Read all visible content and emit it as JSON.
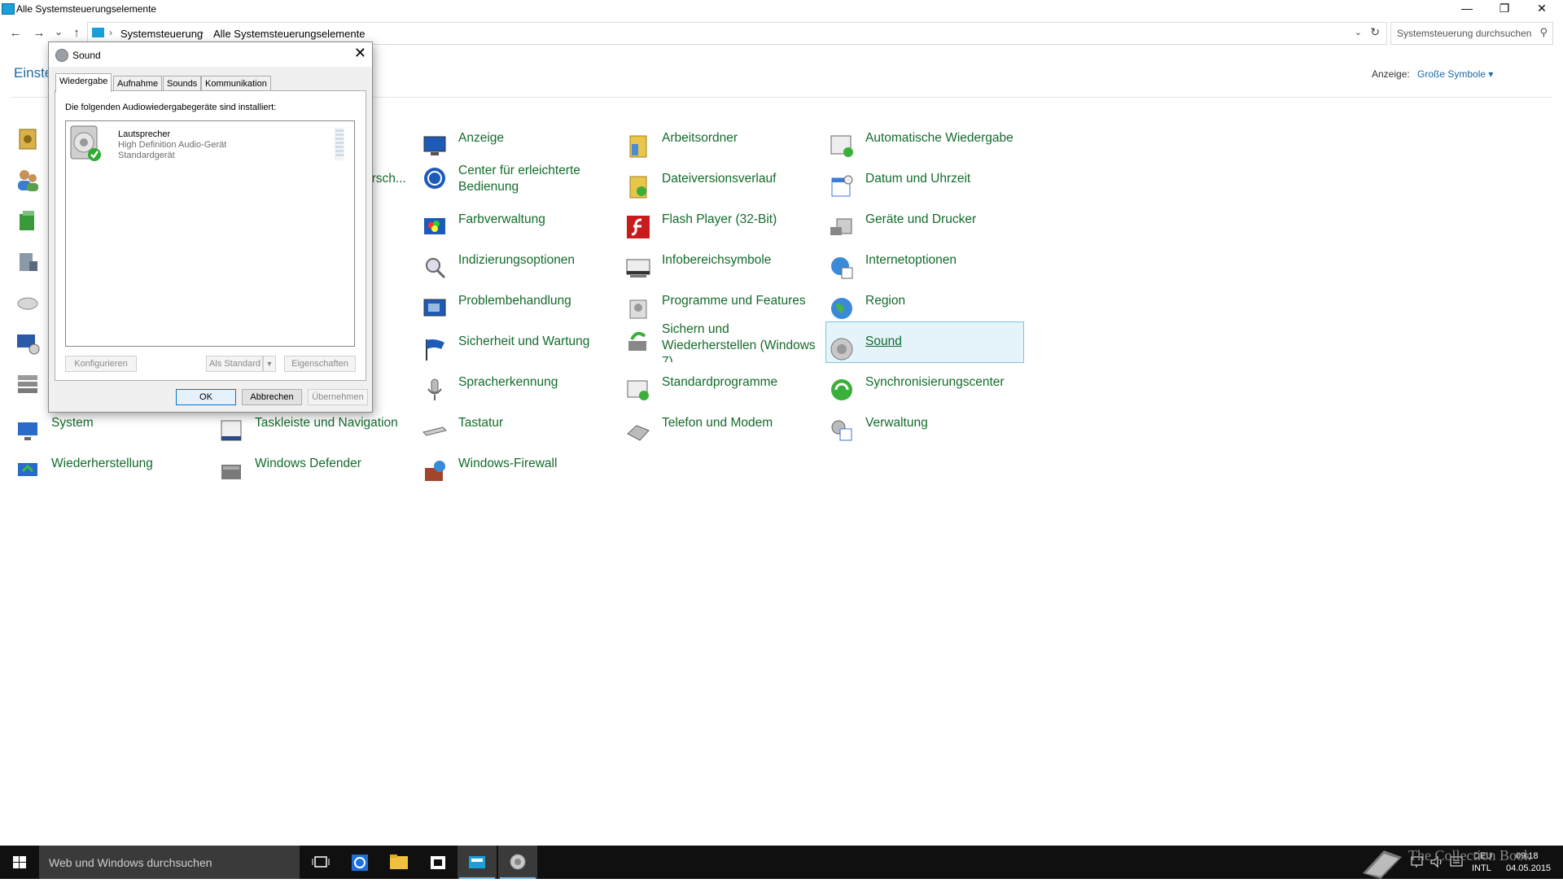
{
  "window": {
    "title": "Alle Systemsteuerungselemente",
    "controls": {
      "minimize": "—",
      "maximize": "❐",
      "close": "✕"
    }
  },
  "nav": {
    "back": "←",
    "forward": "→",
    "recent": "⌄",
    "up": "↑",
    "breadcrumb": [
      "Systemsteuerung",
      "Alle Systemsteuerungselemente"
    ],
    "search_placeholder": "Systemsteuerung durchsuchen"
  },
  "header": {
    "title": "Einste",
    "view_label": "Anzeige:",
    "view_value": "Große Symbole ▾"
  },
  "items": {
    "col0": [
      {
        "label": "",
        "icon": "credential-icon"
      },
      {
        "label": "",
        "icon": "users-icon"
      },
      {
        "label": "",
        "icon": "power-icon"
      },
      {
        "label": "",
        "icon": "network-icon"
      },
      {
        "label": "",
        "icon": "mouse-icon"
      },
      {
        "label": "",
        "icon": "remote-icon"
      },
      {
        "label": "",
        "icon": "storage-icon"
      },
      {
        "label": "System",
        "icon": "system-icon"
      },
      {
        "label": "Wiederherstellung",
        "icon": "recovery-icon"
      }
    ],
    "col1_partial": "ersch...",
    "col1": [
      {
        "label": "Taskleiste und Navigation",
        "icon": "taskbar-icon"
      },
      {
        "label": "Windows Defender",
        "icon": "defender-icon"
      }
    ],
    "col2": [
      {
        "label": "Anzeige",
        "icon": "display-icon"
      },
      {
        "label": "Center für erleichterte Bedienung",
        "icon": "ease-of-access-icon"
      },
      {
        "label": "Farbverwaltung",
        "icon": "color-management-icon"
      },
      {
        "label": "Indizierungsoptionen",
        "icon": "indexing-icon"
      },
      {
        "label": "Problembehandlung",
        "icon": "troubleshooting-icon"
      },
      {
        "label": "Sicherheit und Wartung",
        "icon": "flag-icon"
      },
      {
        "label": "Spracherkennung",
        "icon": "microphone-icon"
      },
      {
        "label": "Tastatur",
        "icon": "keyboard-icon"
      },
      {
        "label": "Windows-Firewall",
        "icon": "firewall-icon"
      }
    ],
    "col3": [
      {
        "label": "Arbeitsordner",
        "icon": "work-folders-icon"
      },
      {
        "label": "Dateiversionsverlauf",
        "icon": "file-history-icon"
      },
      {
        "label": "Flash Player (32-Bit)",
        "icon": "flash-icon"
      },
      {
        "label": "Infobereichsymbole",
        "icon": "notification-icons-icon"
      },
      {
        "label": "Programme und Features",
        "icon": "programs-icon"
      },
      {
        "label": "Sichern und Wiederherstellen (Windows 7)",
        "icon": "backup-icon"
      },
      {
        "label": "Standardprogramme",
        "icon": "default-programs-icon"
      },
      {
        "label": "Telefon und Modem",
        "icon": "phone-icon"
      }
    ],
    "col4": [
      {
        "label": "Automatische Wiedergabe",
        "icon": "autoplay-icon"
      },
      {
        "label": "Datum und Uhrzeit",
        "icon": "calendar-icon"
      },
      {
        "label": "Geräte und Drucker",
        "icon": "printer-icon"
      },
      {
        "label": "Internetoptionen",
        "icon": "internet-options-icon"
      },
      {
        "label": "Region",
        "icon": "globe-icon"
      },
      {
        "label": "Sound",
        "icon": "speaker-icon"
      },
      {
        "label": "Synchronisierungscenter",
        "icon": "sync-icon"
      },
      {
        "label": "Verwaltung",
        "icon": "admin-tools-icon"
      }
    ]
  },
  "dialog": {
    "title": "Sound",
    "close": "✕",
    "tabs": [
      "Wiedergabe",
      "Aufnahme",
      "Sounds",
      "Kommunikation"
    ],
    "active_tab": "Wiedergabe",
    "description": "Die folgenden Audiowiedergabegeräte sind installiert:",
    "device": {
      "name": "Lautsprecher",
      "driver": "High Definition Audio-Gerät",
      "status": "Standardgerät"
    },
    "buttons": {
      "configure": "Konfigurieren",
      "set_default": "Als Standard",
      "properties": "Eigenschaften",
      "ok": "OK",
      "cancel": "Abbrechen",
      "apply": "Übernehmen"
    }
  },
  "taskbar": {
    "search_placeholder": "Web und Windows durchsuchen",
    "language": "DEU",
    "layout": "INTL",
    "time": "09:18",
    "date": "04.05.2015"
  },
  "watermark": "The Collection Book"
}
